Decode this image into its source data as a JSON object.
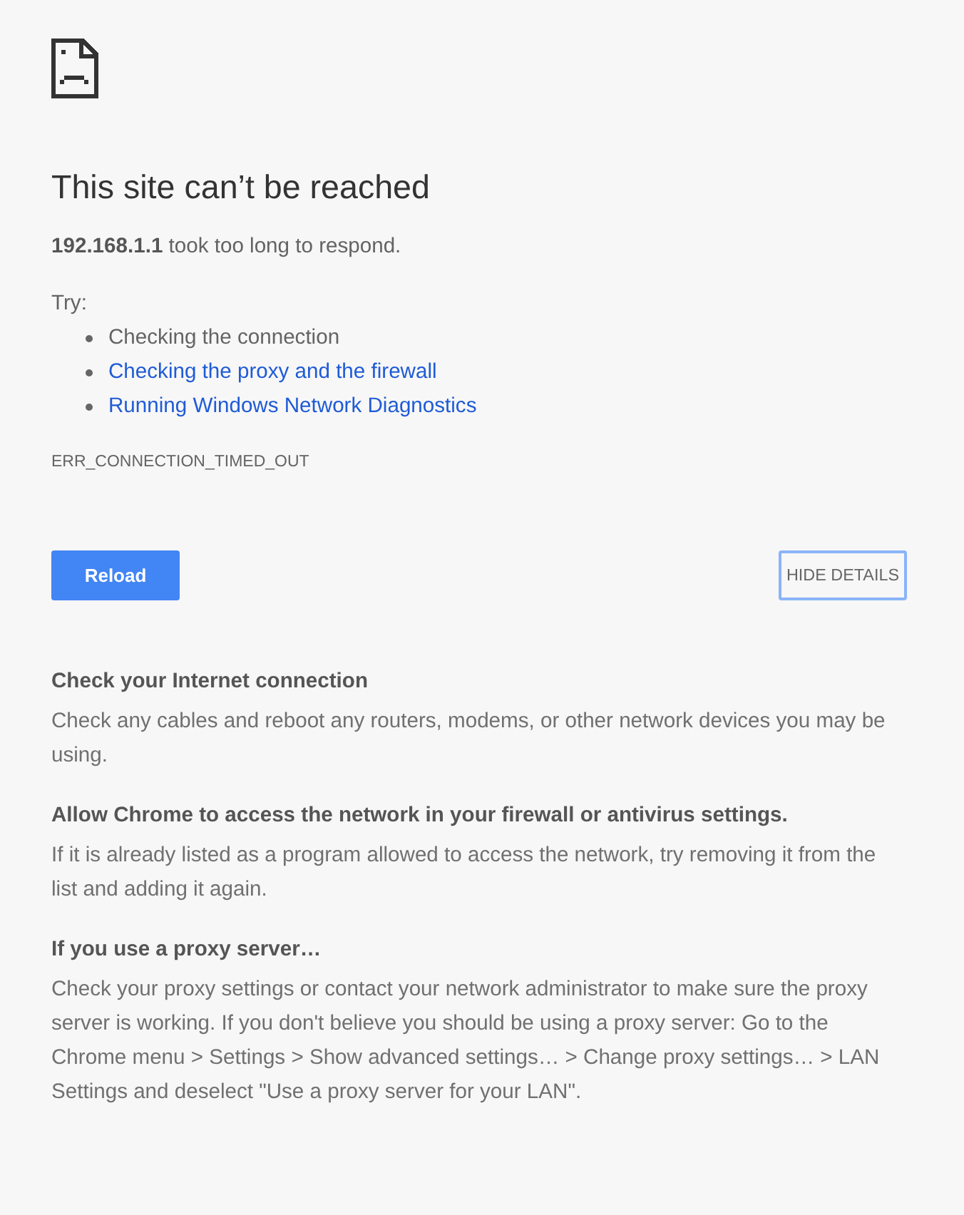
{
  "title": "This site can’t be reached",
  "message": "**192.168.1.1** took too long to respond.",
  "suggestions": {
    "label": "Try:",
    "items": [
      {
        "text": "Checking the connection",
        "kind": "plain"
      },
      {
        "text": "Checking the proxy and the firewall",
        "kind": "link"
      },
      {
        "text": "Running Windows Network Diagnostics",
        "kind": "link"
      }
    ]
  },
  "error_code": "ERR_CONNECTION_TIMED_OUT",
  "buttons": [
    {
      "label": "Reload",
      "kind": "primary",
      "focused": false
    },
    {
      "label": "HIDE DETAILS",
      "kind": "details",
      "focused": true
    }
  ],
  "details": [
    {
      "heading": "Check your Internet connection",
      "body": "Check any cables and reboot any routers, modems, or other network devices you may be using."
    },
    {
      "heading": "Allow Chrome to access the network in your firewall or antivirus settings.",
      "body": "If it is already listed as a program allowed to access the network, try removing it from the list and adding it again."
    },
    {
      "heading": "If you use a proxy server…",
      "body": "Check your proxy settings or contact your network administrator to make sure the proxy server is working. If you don't believe you should be using a proxy server: Go to the Chrome menu > Settings > Show advanced settings… > Change proxy settings… > LAN Settings and deselect \"Use a proxy server for your LAN\"."
    }
  ]
}
